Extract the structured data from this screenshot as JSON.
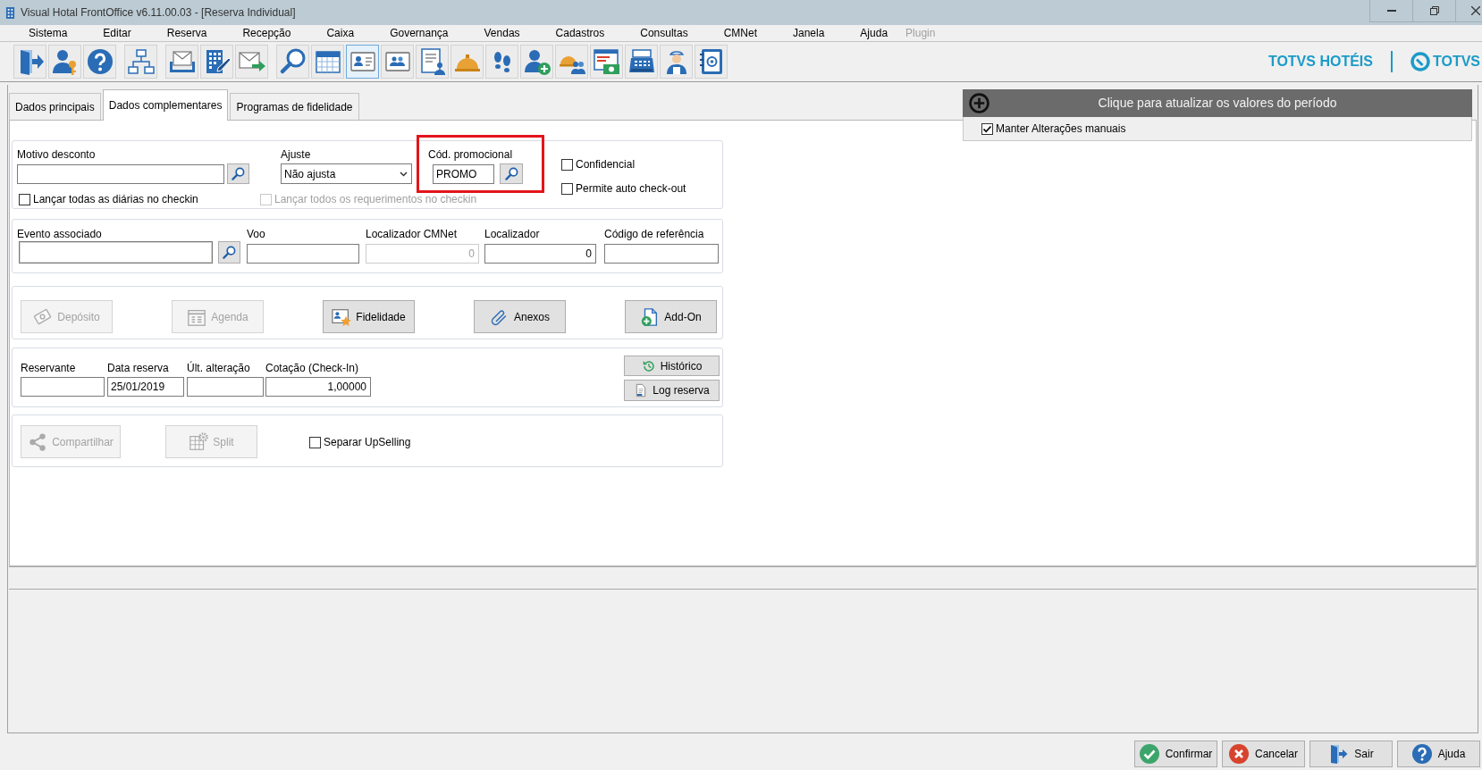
{
  "window": {
    "title": "Visual Hotal FrontOffice v6.11.00.03 - [Reserva Individual]"
  },
  "menu": [
    {
      "label": "Sistema",
      "disabled": false
    },
    {
      "label": "Editar",
      "disabled": false
    },
    {
      "label": "Reserva",
      "disabled": false
    },
    {
      "label": "Recepção",
      "disabled": false
    },
    {
      "label": "Caixa",
      "disabled": false
    },
    {
      "label": "Governança",
      "disabled": false
    },
    {
      "label": "Vendas",
      "disabled": false
    },
    {
      "label": "Cadastros",
      "disabled": false
    },
    {
      "label": "Consultas",
      "disabled": false
    },
    {
      "label": "CMNet",
      "disabled": false
    },
    {
      "label": "Janela",
      "disabled": false
    },
    {
      "label": "Ajuda",
      "disabled": false
    },
    {
      "label": "Plugin",
      "disabled": true
    }
  ],
  "toolbar": {
    "groups": [
      [
        {
          "selected": false
        },
        {
          "selected": false
        },
        {
          "selected": false
        }
      ],
      [
        {
          "selected": false
        }
      ],
      [
        {
          "selected": false
        },
        {
          "selected": false
        },
        {
          "selected": false
        }
      ],
      [
        {
          "selected": false
        },
        {
          "selected": false
        },
        {
          "selected": true
        },
        {
          "selected": false
        },
        {
          "selected": false
        },
        {
          "selected": false
        },
        {
          "selected": false
        },
        {
          "selected": false
        },
        {
          "selected": false
        },
        {
          "selected": false
        },
        {
          "selected": false
        },
        {
          "selected": false
        },
        {
          "selected": false
        }
      ]
    ]
  },
  "brand": {
    "product": "TOTVS HOTÉIS",
    "company": "TOTVS"
  },
  "tabs": [
    {
      "label": "Dados principais",
      "selected": false
    },
    {
      "label": "Dados complementares",
      "selected": true
    },
    {
      "label": "Programas de fidelidade",
      "selected": false
    }
  ],
  "discount": {
    "reason": {
      "label": "Motivo desconto"
    },
    "adjustment": {
      "label": "Ajuste",
      "value": "Não ajusta"
    },
    "promo_code": {
      "label": "Cód. promocional",
      "value": "PROMO",
      "highlighted": true
    },
    "checkin_options": [
      {
        "label": "Lançar todas as diárias no checkin",
        "checked": false,
        "disabled": false
      },
      {
        "label": "Lançar todos os requerimentos no checkin",
        "checked": false,
        "disabled": true
      }
    ],
    "options": [
      {
        "label": "Confidencial",
        "checked": false
      },
      {
        "label": "Permite auto check-out",
        "checked": false
      }
    ]
  },
  "references": {
    "fields": [
      {
        "kind": "lookup",
        "label": "Evento associado",
        "disabled": false
      },
      {
        "kind": "text",
        "label": "Voo",
        "disabled": false
      },
      {
        "kind": "number",
        "label": "Localizador CMNet",
        "value": "0",
        "disabled": true
      },
      {
        "kind": "number",
        "label": "Localizador",
        "value": "0",
        "disabled": false
      },
      {
        "kind": "text",
        "label": "Código de referência",
        "disabled": false
      }
    ]
  },
  "actions": [
    {
      "label": "Depósito",
      "disabled": true
    },
    {
      "label": "Agenda",
      "disabled": true
    },
    {
      "label": "Fidelidade",
      "disabled": false
    },
    {
      "label": "Anexos",
      "disabled": false
    },
    {
      "label": "Add-On",
      "disabled": false
    }
  ],
  "booking": {
    "fields": [
      {
        "kind": "text",
        "label": "Reservante"
      },
      {
        "kind": "text",
        "label": "Data reserva",
        "value": "25/01/2019"
      },
      {
        "kind": "text",
        "label": "Últ. alteração"
      },
      {
        "kind": "number",
        "label": "Cotação (Check-In)",
        "value": "1,00000"
      }
    ],
    "buttons": [
      {
        "label": "Histórico"
      },
      {
        "label": "Log reserva"
      }
    ]
  },
  "sharing": {
    "buttons": [
      {
        "label": "Compartilhar",
        "disabled": true
      },
      {
        "label": "Split",
        "disabled": true
      }
    ],
    "upselling": {
      "label": "Separar UpSelling",
      "checked": false
    }
  },
  "rates_panel": {
    "header": "Clique para atualizar os valores do período",
    "keep_manual": {
      "label": "Manter Alterações manuais",
      "checked": true
    }
  },
  "footer_buttons": [
    {
      "label": "Confirmar"
    },
    {
      "label": "Cancelar"
    },
    {
      "label": "Sair"
    },
    {
      "label": "Ajuda"
    }
  ]
}
